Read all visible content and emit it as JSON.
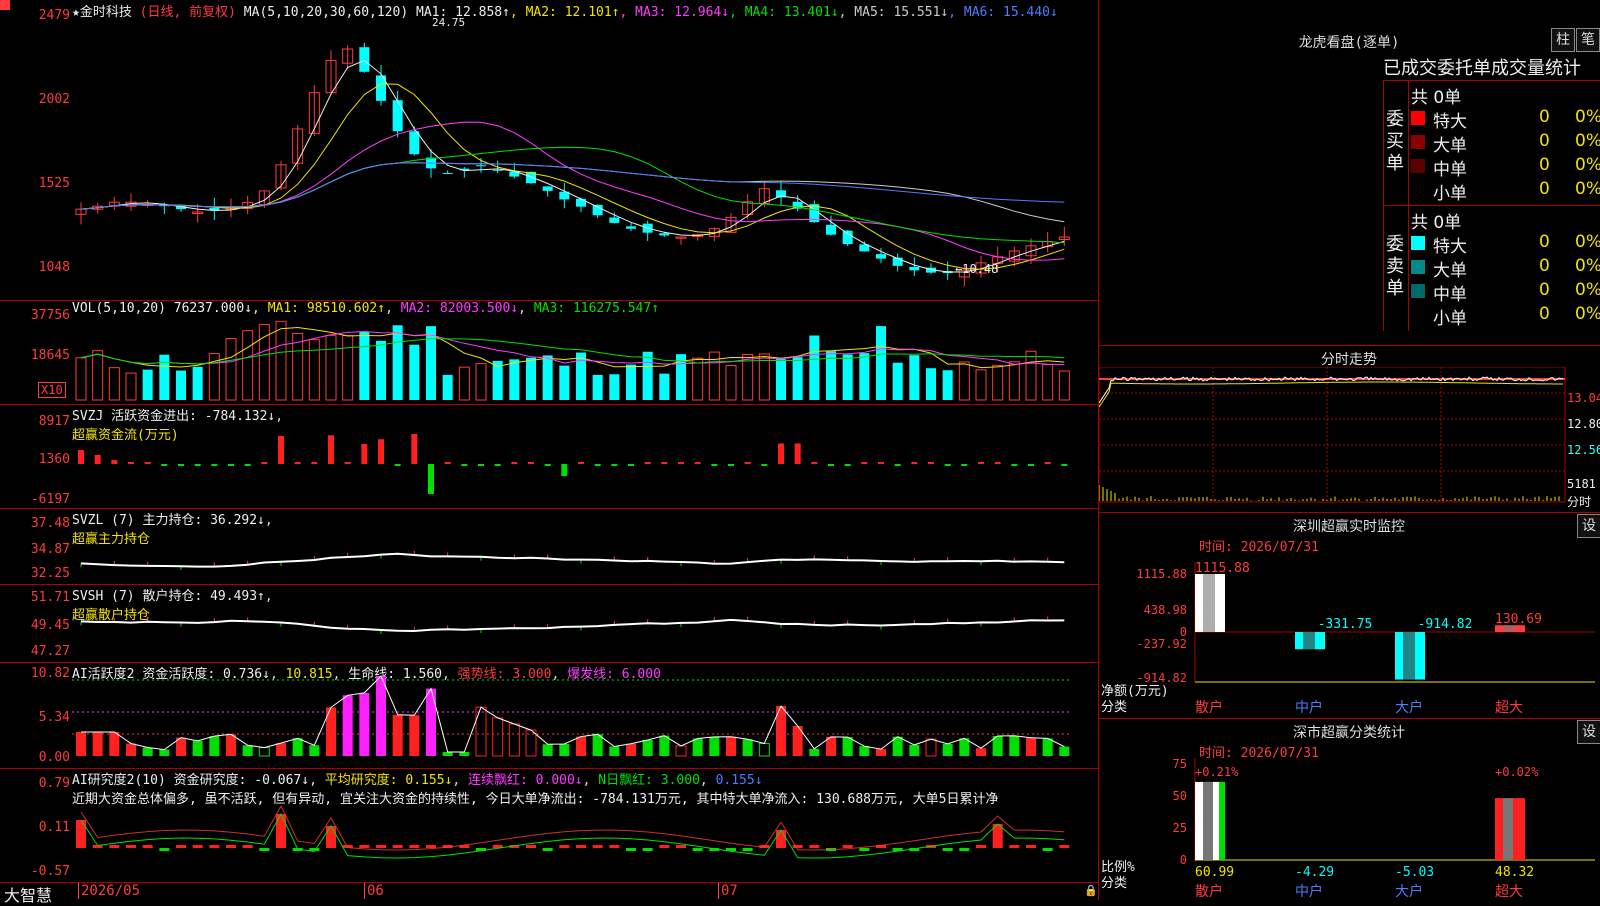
{
  "stock": {
    "title": "★金时科技",
    "mode": "(日线, 前复权)",
    "ma_prefix": "MA(5,10,20,30,60,120)",
    "ma_values": [
      {
        "label": "MA1: 12.858↑",
        "color": "#eeeeee"
      },
      {
        "label": "MA2: 12.101↑",
        "color": "#f2e400"
      },
      {
        "label": "MA3: 12.964↓",
        "color": "#ff3bff"
      },
      {
        "label": "MA4: 13.401↓",
        "color": "#00e000"
      },
      {
        "label": "MA5: 15.551↓",
        "color": "#cccccc"
      },
      {
        "label": "MA6: 15.440↓",
        "color": "#4f7cff"
      }
    ],
    "high_label": "24.75",
    "low_label": "←10.48",
    "price_axis": [
      "2479",
      "2002",
      "1525",
      "1048"
    ]
  },
  "vol": {
    "prefix": "VOL(5,10,20)",
    "value": "76237.000↓",
    "ma1": "MA1: 98510.602↑",
    "ma2": "MA2: 82003.500↓",
    "ma3": "MA3: 116275.547↑",
    "axis": [
      "37756",
      "18645"
    ],
    "unit": "X10"
  },
  "svzj": {
    "prefix": "SVZJ",
    "label": "活跃资金进出: -784.132↓",
    "sub": "超赢资金流(万元)",
    "axis": [
      "8917",
      "1360",
      "-6197"
    ]
  },
  "svzl": {
    "label": "SVZL (7) 主力持仓: 36.292↓",
    "sub": "超赢主力持仓",
    "axis": [
      "37.48",
      "34.87",
      "32.25"
    ]
  },
  "svsh": {
    "label": "SVSH (7) 散户持仓: 49.493↑",
    "sub": "超赢散户持仓",
    "axis": [
      "51.71",
      "49.45",
      "47.27"
    ]
  },
  "ai_active": {
    "label": "AI活跃度2",
    "v1": "资金活跃度: 0.736↓",
    "v2": "10.815",
    "v3": "生命线: 1.560",
    "v4": "强势线: 3.000",
    "v5": "爆发线: 6.000",
    "axis": [
      "10.82",
      "5.34",
      "0.00"
    ]
  },
  "ai_research": {
    "label": "AI研究度2(10)",
    "v1": "资金研究度: -0.067↓",
    "v2": "平均研究度: 0.155↓",
    "v3": "连续飘红: 0.000↓",
    "v4": "N日飘红: 3.000",
    "v5": "0.155↓",
    "comment": "近期大资金总体偏多, 虽不活跃, 但有异动, 宜关注大资金的持续性, 今日大单净流出: -784.131万元, 其中特大单净流入: 130.688万元, 大单5日累计净",
    "axis": [
      "0.79",
      "0.11",
      "-0.57"
    ]
  },
  "bottom": {
    "logo": "大智慧",
    "dates": [
      "2026/05",
      "06",
      "07"
    ]
  },
  "lhb": {
    "title": "龙虎看盘(逐单)",
    "btn1": "柱",
    "btn2": "笔",
    "tabs": "已成交委托单成交量统计",
    "buy_label": "委买单",
    "sell_label": "委卖单",
    "buy_total": "共 0单",
    "sell_total": "共 0单",
    "buy_rows": [
      {
        "name": "特大",
        "count": "0",
        "pct": "0%",
        "color": "#ff0000"
      },
      {
        "name": "大单",
        "count": "0",
        "pct": "0%",
        "color": "#8a0000"
      },
      {
        "name": "中单",
        "count": "0",
        "pct": "0%",
        "color": "#5a0000"
      },
      {
        "name": "小单",
        "count": "0",
        "pct": "0%",
        "color": ""
      }
    ],
    "sell_rows": [
      {
        "name": "特大",
        "count": "0",
        "pct": "0%",
        "color": "#00ffff"
      },
      {
        "name": "大单",
        "count": "0",
        "pct": "0%",
        "color": "#008a8a"
      },
      {
        "name": "中单",
        "count": "0",
        "pct": "0%",
        "color": "#006a6a"
      },
      {
        "name": "小单",
        "count": "0",
        "pct": "0%",
        "color": ""
      }
    ]
  },
  "intraday": {
    "title": "分时走势",
    "axis": [
      "13.04",
      "12.80",
      "12.56",
      "5181"
    ],
    "vol_label": "分时"
  },
  "sz_monitor": {
    "title": "深圳超赢实时监控",
    "btn": "设",
    "time": "时间: 2026/07/31",
    "axis": [
      "1115.88",
      "438.98",
      "0",
      "-237.92",
      "-914.82"
    ],
    "ylabel": "净额(万元)",
    "xlabel": "分类",
    "bars": [
      {
        "name": "散户",
        "value": 1115.88,
        "label": "1115.88",
        "color": "#ffffff"
      },
      {
        "name": "中户",
        "value": -331.75,
        "label": "-331.75",
        "color": "#00ffff"
      },
      {
        "name": "大户",
        "value": -914.82,
        "label": "-914.82",
        "color": "#00ffff"
      },
      {
        "name": "超大",
        "value": 130.69,
        "label": "130.69",
        "color": "#ff3b3b"
      }
    ]
  },
  "sz_class": {
    "title": "深市超赢分类统计",
    "btn": "设",
    "time": "时间: 2026/07/31",
    "axis": [
      "75",
      "50",
      "25",
      "0"
    ],
    "ylabel": "比例%",
    "xlabel": "分类",
    "bars": [
      {
        "name": "散户",
        "top": "+0.21%",
        "value": 60.99,
        "label": "60.99"
      },
      {
        "name": "中户",
        "top": "",
        "value": -4.29,
        "label": "-4.29"
      },
      {
        "name": "大户",
        "top": "",
        "value": -5.03,
        "label": "-5.03"
      },
      {
        "name": "超大",
        "top": "+0.02%",
        "value": 48.32,
        "label": "48.32"
      }
    ]
  }
}
